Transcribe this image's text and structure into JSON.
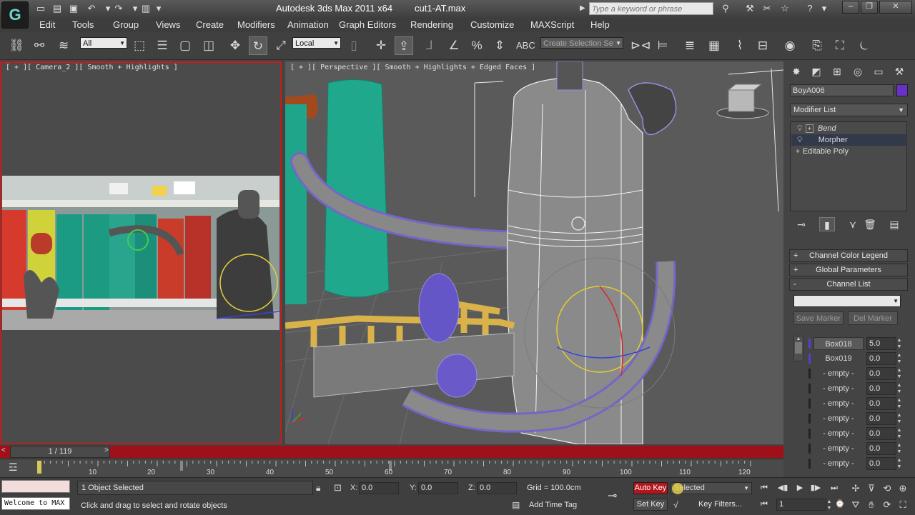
{
  "window": {
    "title": "Autodesk 3ds Max  2011 x64",
    "file": "cut1-AT.max",
    "search_placeholder": "Type a keyword or phrase",
    "logo": "G"
  },
  "menu": [
    "Edit",
    "Tools",
    "Group",
    "Views",
    "Create",
    "Modifiers",
    "Animation",
    "Graph Editors",
    "Rendering",
    "Customize",
    "MAXScript",
    "Help"
  ],
  "toolbar": {
    "selection_filter": "All",
    "ref_coord": "Local",
    "named_selection": "Create Selection Se"
  },
  "viewports": {
    "left_label": "[ + ][ Camera_2 ][ Smooth + Highlights ]",
    "right_label": "[ + ][ Perspective ][ Smooth + Highlights + Edged Faces ]"
  },
  "command_panel": {
    "object_name": "BoyA006",
    "object_color": "#6a2fc6",
    "modifier_list": "Modifier List",
    "stack": [
      {
        "label": "Bend",
        "italic": true,
        "selected": false
      },
      {
        "label": "Morpher",
        "italic": false,
        "selected": true
      },
      {
        "label": "Editable Poly",
        "italic": false,
        "selected": false
      }
    ],
    "rollouts": [
      {
        "sign": "+",
        "label": "Channel Color Legend"
      },
      {
        "sign": "+",
        "label": "Global Parameters"
      },
      {
        "sign": "-",
        "label": "Channel List"
      }
    ],
    "save_marker": "Save Marker",
    "del_marker": "Del Marker",
    "channels": [
      {
        "name": "Box018",
        "value": "5.0"
      },
      {
        "name": "Box019",
        "value": "0.0"
      },
      {
        "name": "- empty -",
        "value": "0.0"
      },
      {
        "name": "- empty -",
        "value": "0.0"
      },
      {
        "name": "- empty -",
        "value": "0.0"
      },
      {
        "name": "- empty -",
        "value": "0.0"
      },
      {
        "name": "- empty -",
        "value": "0.0"
      },
      {
        "name": "- empty -",
        "value": "0.0"
      },
      {
        "name": "- empty -",
        "value": "0.0"
      }
    ]
  },
  "timeline": {
    "frame_display": "1 / 119",
    "ticks": [
      "10",
      "20",
      "30",
      "40",
      "50",
      "60",
      "70",
      "80",
      "90",
      "100",
      "110",
      "120"
    ]
  },
  "status": {
    "maxscript_text": "Welcome to MAX",
    "selection": "1 Object Selected",
    "prompt": "Click and drag to select and rotate objects",
    "x_label": "X:",
    "x_value": "0.0",
    "y_label": "Y:",
    "y_value": "0.0",
    "z_label": "Z:",
    "z_value": "0.0",
    "grid": "Grid = 100.0cm",
    "add_time_tag": "Add Time Tag",
    "auto_key": "Auto Key",
    "set_key": "Set Key",
    "key_mode": "Selected",
    "key_filters": "Key Filters...",
    "current_frame": "1"
  },
  "colors": {
    "active_viewport_border": "#c21d1d",
    "time_slider": "#a01018",
    "auto_key": "#b4141c"
  }
}
